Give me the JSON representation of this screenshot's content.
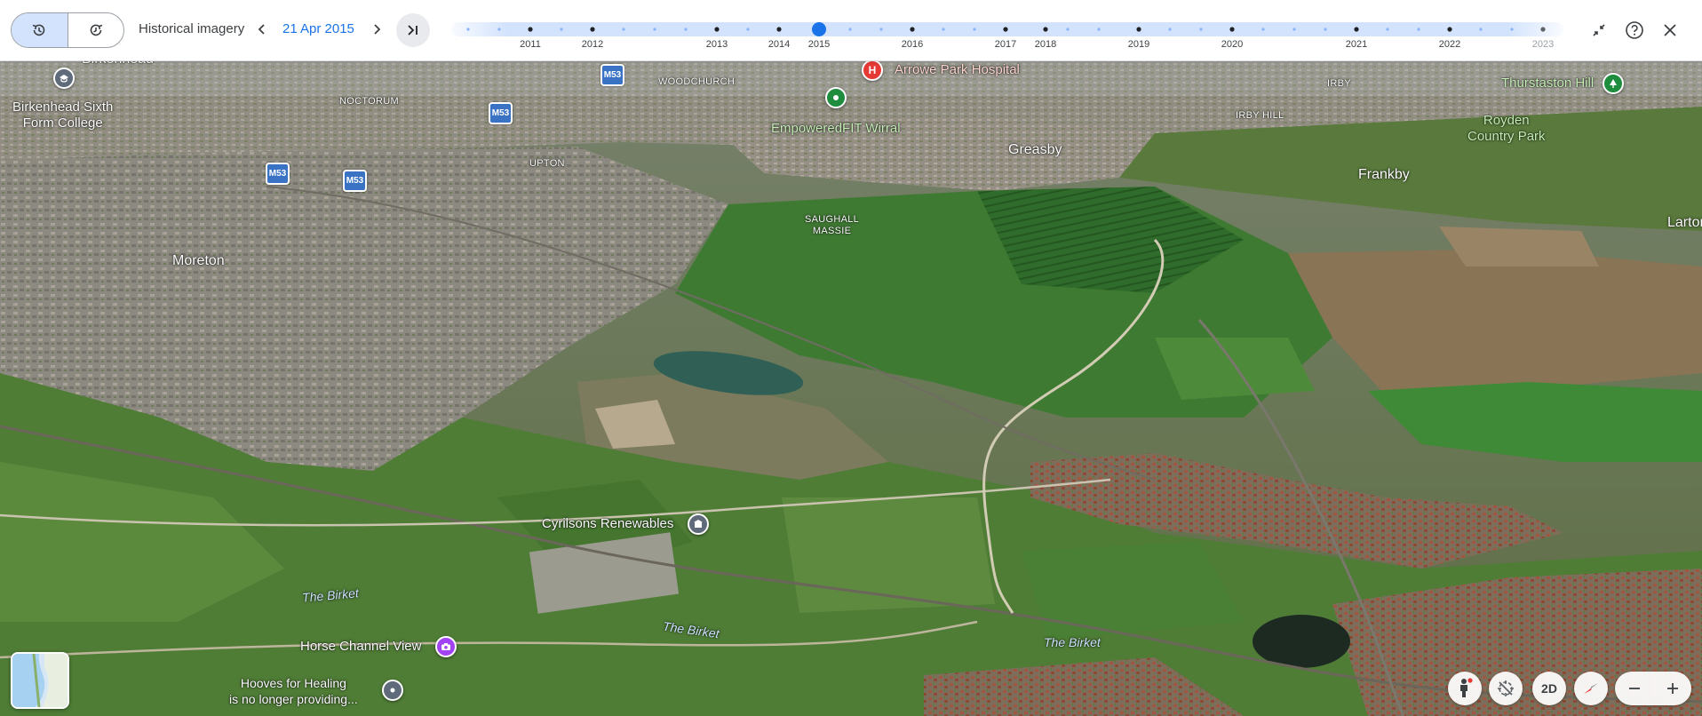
{
  "history": {
    "label": "Historical imagery",
    "date": "21 Apr 2015",
    "selected_year": "2015",
    "years": [
      "2011",
      "2012",
      "2013",
      "2014",
      "2015",
      "2016",
      "2017",
      "2018",
      "2019",
      "2020",
      "2021",
      "2022",
      "2023"
    ]
  },
  "map": {
    "places": {
      "birkenhead_partial": "Birkenhead",
      "birkenhead_college_1": "Birkenhead Sixth",
      "birkenhead_college_2": "Form College",
      "noctorum": "NOCTORUM",
      "woodchurch": "WOODCHURCH",
      "upton": "UPTON",
      "moreton": "Moreton",
      "saughall_1": "SAUGHALL",
      "saughall_2": "MASSIE",
      "arrowe": "Arrowe Park Hospital",
      "empowered": "EmpoweredFIT Wirral",
      "greasby": "Greasby",
      "irby": "IRBY",
      "irby_hill": "IRBY HILL",
      "frankby": "Frankby",
      "thurstaston": "Thurstaston Hill",
      "royden_1": "Royden",
      "royden_2": "Country Park",
      "larton": "Larton",
      "cyrilsons": "Cyrilsons Renewables",
      "birket_1": "The Birket",
      "birket_2": "The Birket",
      "birket_3": "The Birket",
      "horse": "Horse Channel View",
      "hooves_1": "Hooves for Healing",
      "hooves_2": "is no longer providing..."
    },
    "shields": {
      "m53_1": "M53",
      "m53_2": "M53",
      "m53_3": "M53",
      "m53_4": "M53"
    },
    "colors": {
      "accent": "#1a73e8",
      "hospital": "#e53935",
      "fitness": "#1e8e3e",
      "park": "#1e8e3e",
      "photo": "#a142f4",
      "generic_poi": "#5f6b7a"
    }
  },
  "controls": {
    "view_mode": "2D"
  }
}
